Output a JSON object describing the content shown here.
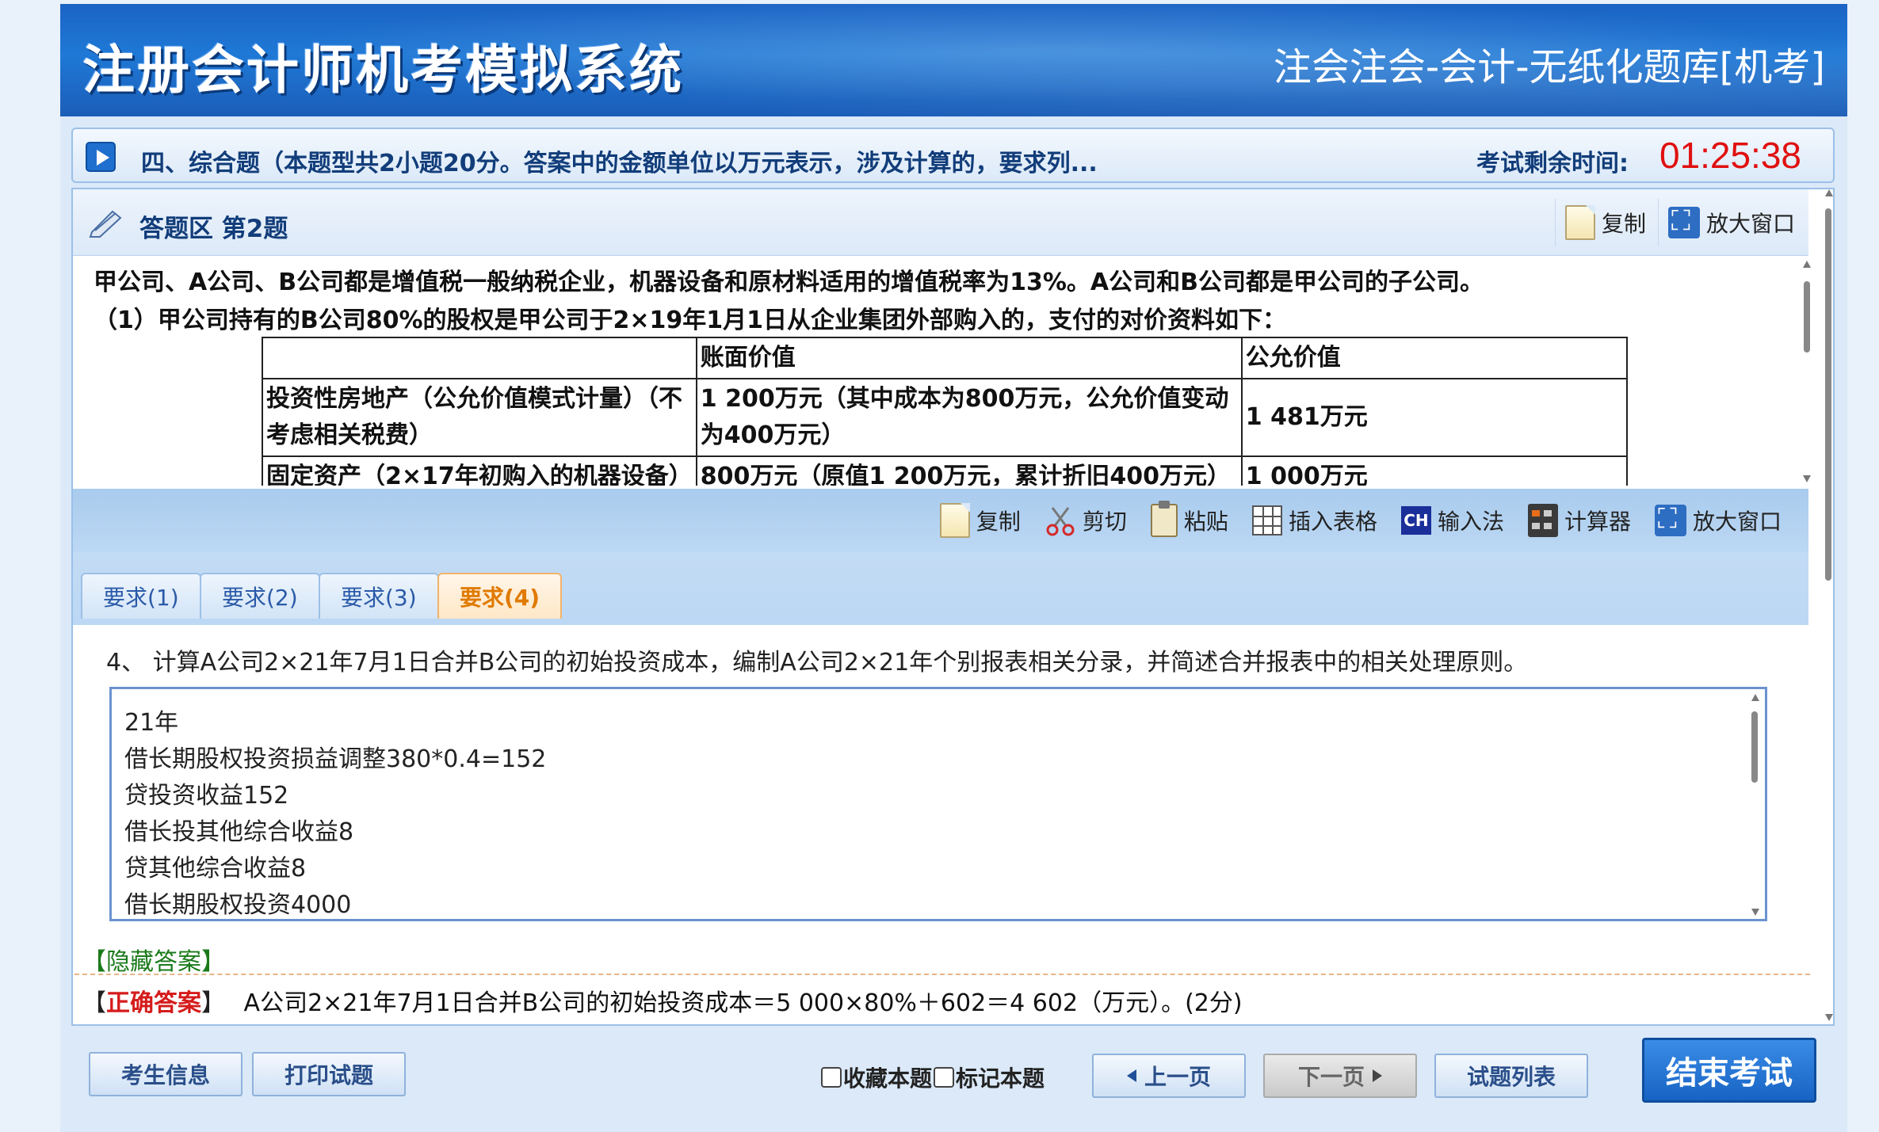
{
  "header": {
    "logo": "注册会计师机考模拟系统",
    "bank_title": "注会注会-会计-无纸化题库[机考]"
  },
  "section": {
    "title": "四、综合题（本题型共2小题20分。答案中的金额单位以万元表示，涉及计算的，要求列...",
    "time_label": "考试剩余时间:",
    "time_value": "01:25:38"
  },
  "answer_area": {
    "title": "答题区 第2题",
    "copy_label": "复制",
    "expand_label": "放大窗口"
  },
  "material": {
    "line1": "甲公司、A公司、B公司都是增值税一般纳税企业，机器设备和原材料适用的增值税率为13%。A公司和B公司都是甲公司的子公司。",
    "line2": "（1）甲公司持有的B公司80%的股权是甲公司于2×19年1月1日从企业集团外部购入的，支付的对价资料如下：",
    "table": {
      "headers": [
        "",
        "账面价值",
        "公允价值"
      ],
      "rows": [
        [
          "投资性房地产（公允价值模式计量）（不考虑相关税费）",
          "1 200万元（其中成本为800万元，公允价值变动为400万元）",
          "1 481万元"
        ],
        [
          "固定资产（2×17年初购入的机器设备）",
          "800万元（原值1 200万元，累计折旧400万元）",
          "1 000万元"
        ]
      ]
    }
  },
  "toolbar": {
    "copy": "复制",
    "cut": "剪切",
    "paste": "粘贴",
    "insert_table": "插入表格",
    "input_method": "输入法",
    "calculator": "计算器",
    "expand": "放大窗口"
  },
  "tabs": [
    "要求(1)",
    "要求(2)",
    "要求(3)",
    "要求(4)"
  ],
  "active_tab": 3,
  "requirement": "4、 计算A公司2×21年7月1日合并B公司的初始投资成本，编制A公司2×21年个别报表相关分录，并简述合并报表中的相关处理原则。",
  "answer_lines": [
    "21年",
    "借长期股权投资损益调整380*0.4=152",
    "贷投资收益152",
    "借长投其他综合收益8",
    "贷其他综合收益8",
    "借长期股权投资4000"
  ],
  "hide_answer": "【隐藏答案】",
  "correct_answer": {
    "tag": "正确答案",
    "text": "A公司2×21年7月1日合并B公司的初始投资成本＝5 000×80%＋602＝4 602（万元）。(2分)"
  },
  "footer": {
    "student_info": "考生信息",
    "print": "打印试题",
    "favorite": "收藏本题",
    "mark": "标记本题",
    "prev": "上一页",
    "next": "下一页",
    "question_list": "试题列表",
    "end_exam": "结束考试"
  }
}
